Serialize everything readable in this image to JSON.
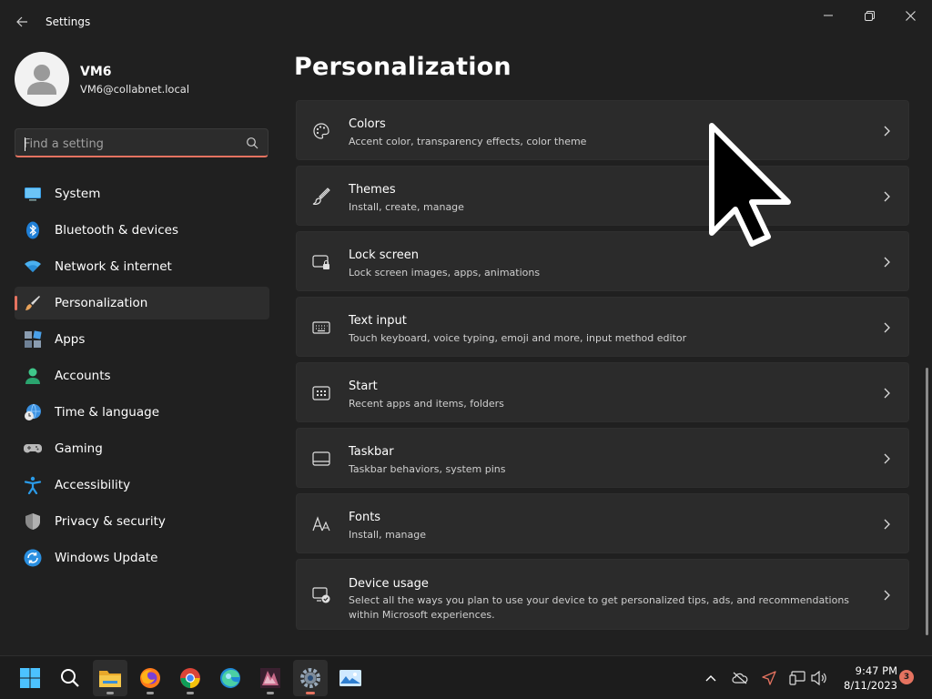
{
  "window": {
    "title": "Settings"
  },
  "user": {
    "name": "VM6",
    "email": "VM6@collabnet.local"
  },
  "search": {
    "placeholder": "Find a setting"
  },
  "sidebar": {
    "items": [
      {
        "label": "System",
        "icon": "system-icon"
      },
      {
        "label": "Bluetooth & devices",
        "icon": "bluetooth-icon"
      },
      {
        "label": "Network & internet",
        "icon": "wifi-icon"
      },
      {
        "label": "Personalization",
        "icon": "brush-icon",
        "active": true
      },
      {
        "label": "Apps",
        "icon": "apps-icon"
      },
      {
        "label": "Accounts",
        "icon": "account-icon"
      },
      {
        "label": "Time & language",
        "icon": "globe-clock-icon"
      },
      {
        "label": "Gaming",
        "icon": "gamepad-icon"
      },
      {
        "label": "Accessibility",
        "icon": "accessibility-icon"
      },
      {
        "label": "Privacy & security",
        "icon": "shield-icon"
      },
      {
        "label": "Windows Update",
        "icon": "update-icon"
      }
    ]
  },
  "main": {
    "title": "Personalization",
    "cards": [
      {
        "title": "Colors",
        "desc": "Accent color, transparency effects, color theme",
        "icon": "palette-icon"
      },
      {
        "title": "Themes",
        "desc": "Install, create, manage",
        "icon": "brush-icon"
      },
      {
        "title": "Lock screen",
        "desc": "Lock screen images, apps, animations",
        "icon": "lock-screen-icon"
      },
      {
        "title": "Text input",
        "desc": "Touch keyboard, voice typing, emoji and more, input method editor",
        "icon": "keyboard-icon"
      },
      {
        "title": "Start",
        "desc": "Recent apps and items, folders",
        "icon": "start-grid-icon"
      },
      {
        "title": "Taskbar",
        "desc": "Taskbar behaviors, system pins",
        "icon": "taskbar-icon"
      },
      {
        "title": "Fonts",
        "desc": "Install, manage",
        "icon": "fonts-icon"
      },
      {
        "title": "Device usage",
        "desc": "Select all the ways you plan to use your device to get personalized tips, ads, and recommendations within Microsoft experiences.",
        "icon": "device-usage-icon"
      }
    ]
  },
  "taskbar": {
    "apps": [
      "start-icon",
      "search-icon",
      "file-explorer-icon",
      "firefox-icon",
      "chrome-icon",
      "edge-icon",
      "media-app-icon",
      "settings-icon",
      "photos-icon"
    ],
    "clock": {
      "time": "9:47 PM",
      "date": "8/11/2023"
    },
    "notifications": "3"
  },
  "colors": {
    "accent": "#e57360",
    "background": "#202020",
    "card": "#2b2b2b"
  }
}
